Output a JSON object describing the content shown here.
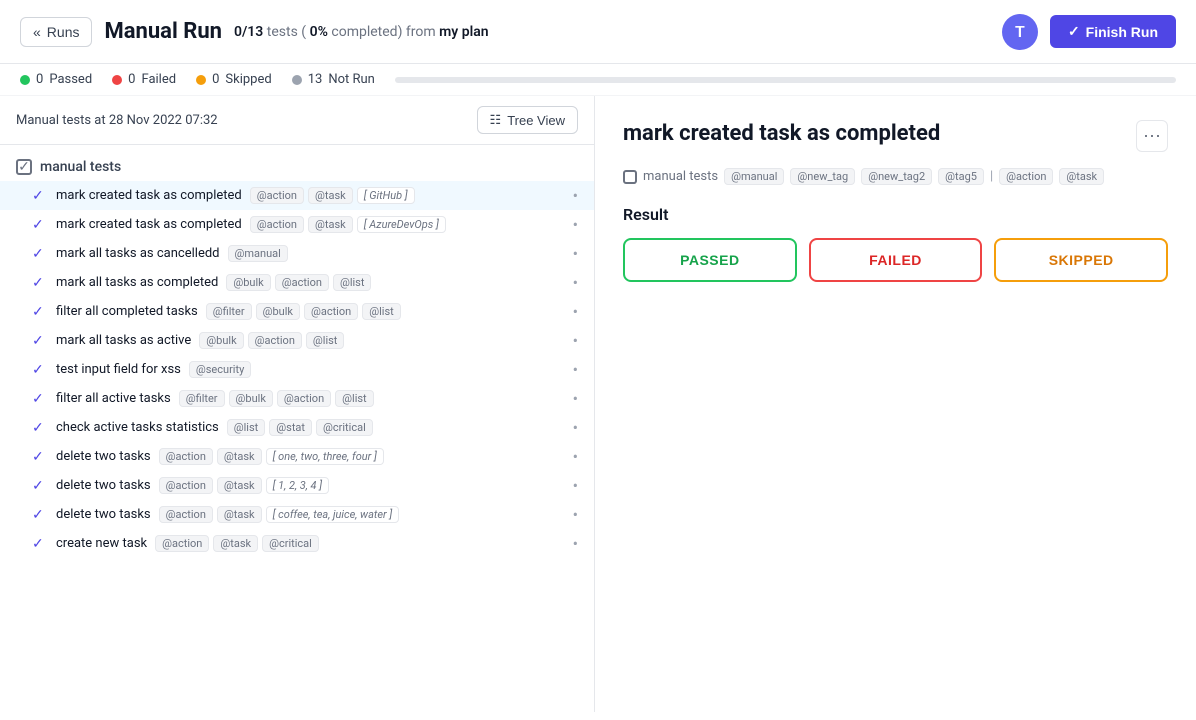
{
  "header": {
    "back_label": "Runs",
    "title": "Manual Run",
    "subtitle_count": "0/13",
    "subtitle_percent": "0%",
    "subtitle_text": "tests (",
    "subtitle_completed": "completed) from",
    "subtitle_plan": "my plan",
    "avatar_letter": "T",
    "finish_button_label": "Finish Run"
  },
  "stats": {
    "passed_count": "0",
    "passed_label": "Passed",
    "failed_count": "0",
    "failed_label": "Failed",
    "skipped_count": "0",
    "skipped_label": "Skipped",
    "notrun_count": "13",
    "notrun_label": "Not Run",
    "progress_percent": 0
  },
  "left_panel": {
    "date_label": "Manual tests at 28 Nov 2022 07:32",
    "tree_view_button": "Tree View",
    "group_label": "manual tests",
    "tests": [
      {
        "name": "mark created task as completed",
        "tags": [
          "@action",
          "@task"
        ],
        "params": "[ GitHub ]",
        "active": true
      },
      {
        "name": "mark created task as completed",
        "tags": [
          "@action",
          "@task"
        ],
        "params": "[ AzureDevOps ]",
        "active": false
      },
      {
        "name": "mark all tasks as cancelledd",
        "tags": [
          "@manual"
        ],
        "params": "",
        "active": false
      },
      {
        "name": "mark all tasks as completed",
        "tags": [
          "@bulk",
          "@action",
          "@list"
        ],
        "params": "",
        "active": false
      },
      {
        "name": "filter all completed tasks",
        "tags": [
          "@filter",
          "@bulk",
          "@action",
          "@list"
        ],
        "params": "",
        "active": false
      },
      {
        "name": "mark all tasks as active",
        "tags": [
          "@bulk",
          "@action",
          "@list"
        ],
        "params": "",
        "active": false
      },
      {
        "name": "test input field for xss",
        "tags": [
          "@security"
        ],
        "params": "",
        "active": false
      },
      {
        "name": "filter all active tasks",
        "tags": [
          "@filter",
          "@bulk",
          "@action",
          "@list"
        ],
        "params": "",
        "active": false
      },
      {
        "name": "check active tasks statistics",
        "tags": [
          "@list",
          "@stat",
          "@critical"
        ],
        "params": "",
        "active": false
      },
      {
        "name": "delete two tasks",
        "tags": [
          "@action",
          "@task"
        ],
        "params": "[ one, two, three, four ]",
        "active": false
      },
      {
        "name": "delete two tasks",
        "tags": [
          "@action",
          "@task"
        ],
        "params": "[ 1, 2, 3, 4 ]",
        "active": false
      },
      {
        "name": "delete two tasks",
        "tags": [
          "@action",
          "@task"
        ],
        "params": "[ coffee, tea, juice, water ]",
        "active": false
      },
      {
        "name": "create new task",
        "tags": [
          "@action",
          "@task",
          "@critical"
        ],
        "params": "",
        "active": false
      }
    ]
  },
  "right_panel": {
    "title": "mark created task as completed",
    "breadcrumb": {
      "group": "manual tests",
      "tags": [
        "@manual",
        "@new_tag",
        "@new_tag2",
        "@tag5"
      ],
      "separator": "|",
      "extra_tags": [
        "@action",
        "@task"
      ]
    },
    "result_section_label": "Result",
    "passed_label": "PASSED",
    "failed_label": "FAILED",
    "skipped_label": "SKIPPED"
  }
}
